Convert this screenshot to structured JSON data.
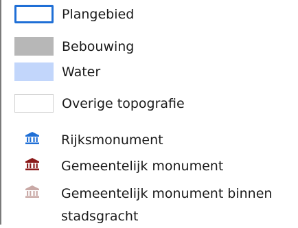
{
  "legend": {
    "areas": [
      {
        "label": "Plangebied",
        "icon": "outline-swatch"
      },
      {
        "label": "Bebouwing",
        "icon": "gray-swatch"
      },
      {
        "label": "Water",
        "icon": "lightblue-swatch"
      },
      {
        "label": "Overige topografie",
        "icon": "white-swatch"
      }
    ],
    "monuments": [
      {
        "label": "Rijksmonument",
        "icon": "building-icon",
        "color": "#1f6fd6"
      },
      {
        "label": "Gemeentelijk monument",
        "icon": "building-icon",
        "color": "#8b1a1a"
      },
      {
        "label": "Gemeentelijk monument binnen stadsgracht",
        "icon": "building-icon",
        "color": "#c9a9a6"
      }
    ]
  }
}
